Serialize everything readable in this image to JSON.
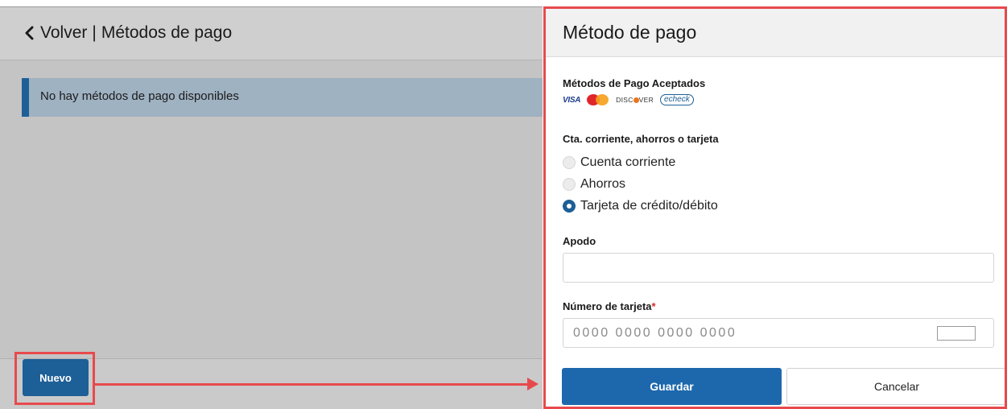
{
  "left": {
    "back_label": "Volver",
    "separator": "|",
    "page_title": "Métodos de pago",
    "notice_text": "No hay métodos de pago disponibles",
    "new_button": "Nuevo"
  },
  "right": {
    "title": "Método de pago",
    "accepted_label": "Métodos de Pago Aceptados",
    "cards": {
      "visa": "VISA",
      "discover": [
        "DISC",
        "VER"
      ],
      "echeck": "echeck"
    },
    "account_type_label": "Cta. corriente, ahorros o tarjeta",
    "options": [
      {
        "label": "Cuenta corriente",
        "selected": false
      },
      {
        "label": "Ahorros",
        "selected": false
      },
      {
        "label": "Tarjeta de crédito/débito",
        "selected": true
      }
    ],
    "nickname_label": "Apodo",
    "nickname_value": "",
    "card_number_label": "Número de tarjeta",
    "required_mark": "*",
    "card_number_placeholder": "0000 0000 0000 0000",
    "save_button": "Guardar",
    "cancel_button": "Cancelar"
  },
  "colors": {
    "accent": "#1d5f97",
    "highlight": "#e74a4d",
    "panel_bg": "#c4c4c4",
    "notice_bg": "#9fb2c2"
  },
  "icons": {
    "back": "chevron-left-icon",
    "arrow": "arrow-right-icon"
  }
}
